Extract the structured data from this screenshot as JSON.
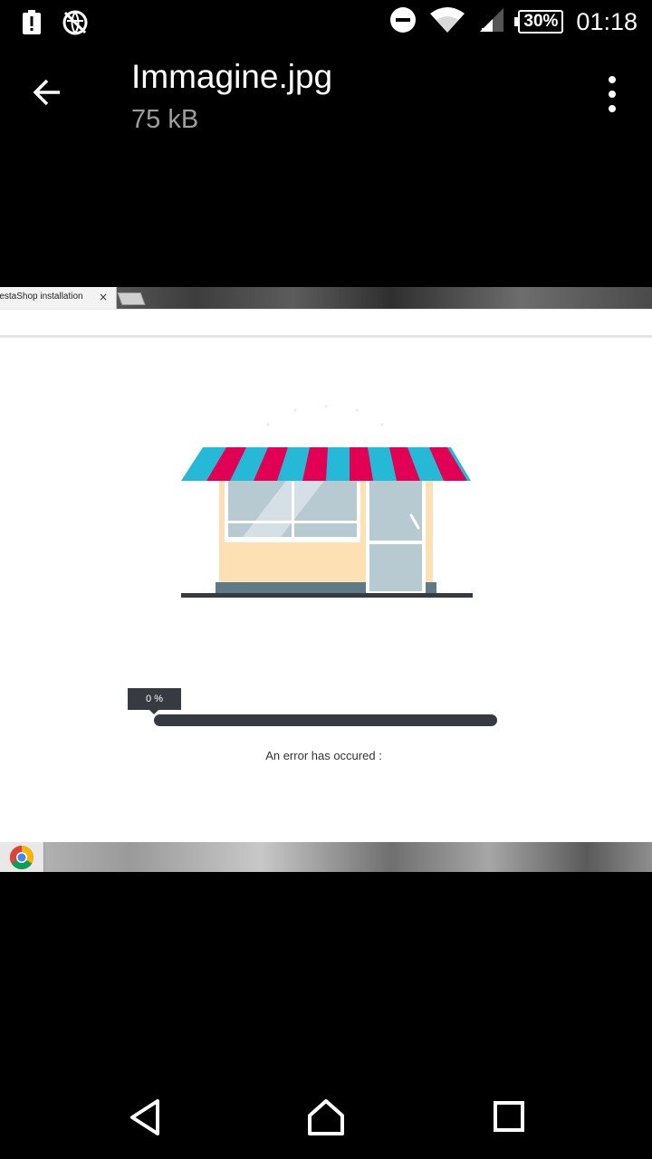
{
  "status_bar": {
    "battery_percent": "30%",
    "time": "01:18",
    "icons": [
      "battery-alert-icon",
      "no-data-icon",
      "do-not-disturb-icon",
      "wifi-icon",
      "signal-icon",
      "battery-icon"
    ]
  },
  "app_bar": {
    "title": "Immagine.jpg",
    "subtitle": "75 kB",
    "icons": [
      "back-arrow-icon",
      "overflow-menu-icon"
    ]
  },
  "screenshot_content": {
    "tab_title": "restaShop installation",
    "tab_close": "×",
    "progress_label": "0 %",
    "progress_value": 0,
    "error_text": "An error has occured :",
    "colors": {
      "awning_pink": "#e10054",
      "awning_blue": "#25b9d7",
      "dark": "#363a41",
      "wall": "#fde1b5",
      "glass": "#b7c9d1"
    }
  },
  "nav_bar": {
    "icons": [
      "nav-back-icon",
      "nav-home-icon",
      "nav-recents-icon"
    ]
  }
}
